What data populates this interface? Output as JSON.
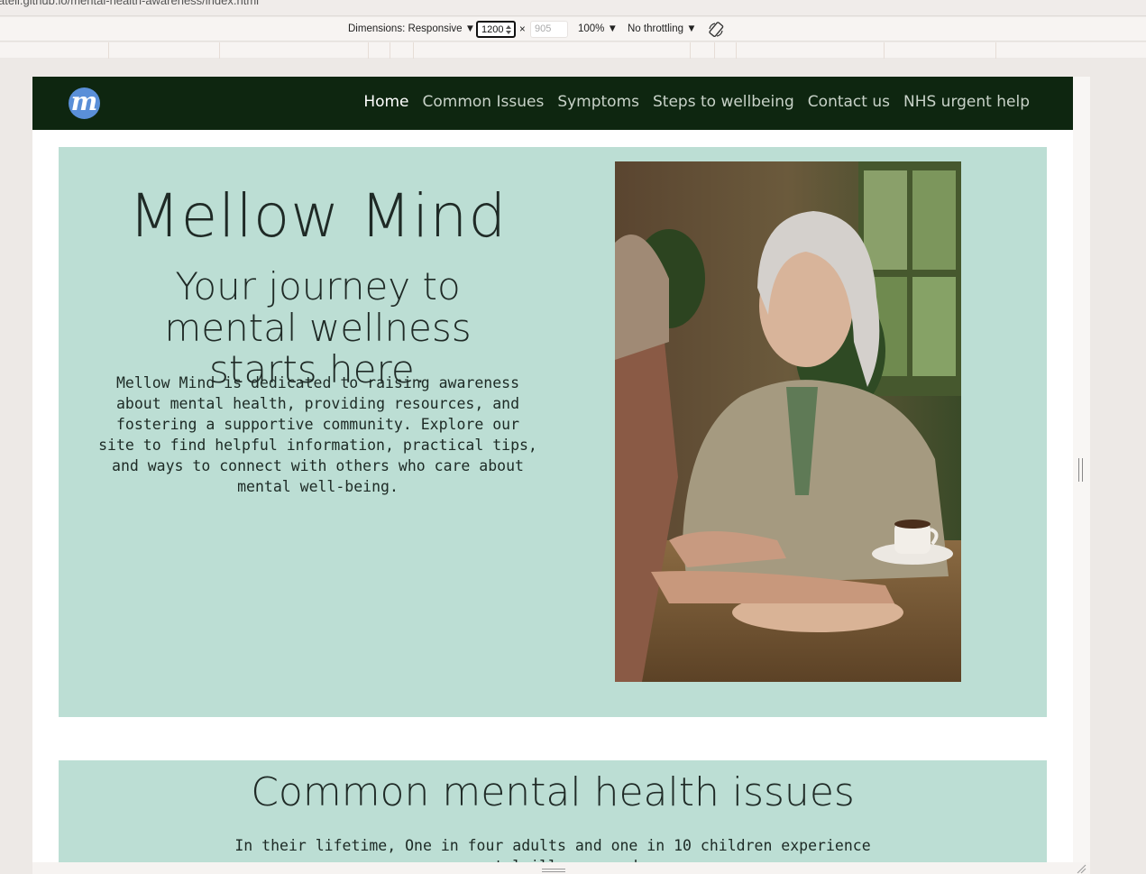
{
  "browser": {
    "url_partial": "atell.github.io/mental-health-awareness/index.html"
  },
  "devtools": {
    "dimensions_label": "Dimensions: Responsive ▼",
    "width_value": "1200",
    "times": "×",
    "height_placeholder": "905",
    "zoom": "100% ▼",
    "throttling": "No throttling ▼"
  },
  "site": {
    "logo_letter": "m",
    "nav": [
      {
        "label": "Home",
        "active": true
      },
      {
        "label": "Common Issues"
      },
      {
        "label": "Symptoms"
      },
      {
        "label": "Steps to wellbeing"
      },
      {
        "label": "Contact us"
      },
      {
        "label": "NHS urgent help"
      }
    ],
    "hero": {
      "title": "Mellow Mind",
      "subtitle": "Your journey to mental wellness starts here.",
      "text": "Mellow Mind is dedicated to raising awareness about mental health, providing resources, and fostering a supportive community. Explore our site to find helpful information, practical tips, and ways to connect with others who care about mental well-being."
    },
    "issues": {
      "title": "Common mental health issues",
      "text": "In their lifetime, One in four adults and one in 10 children experience mental illness, and"
    }
  },
  "colors": {
    "navbar_bg": "#0e2610",
    "section_bg": "#bcded4",
    "logo_bg": "#5a8fd8"
  }
}
